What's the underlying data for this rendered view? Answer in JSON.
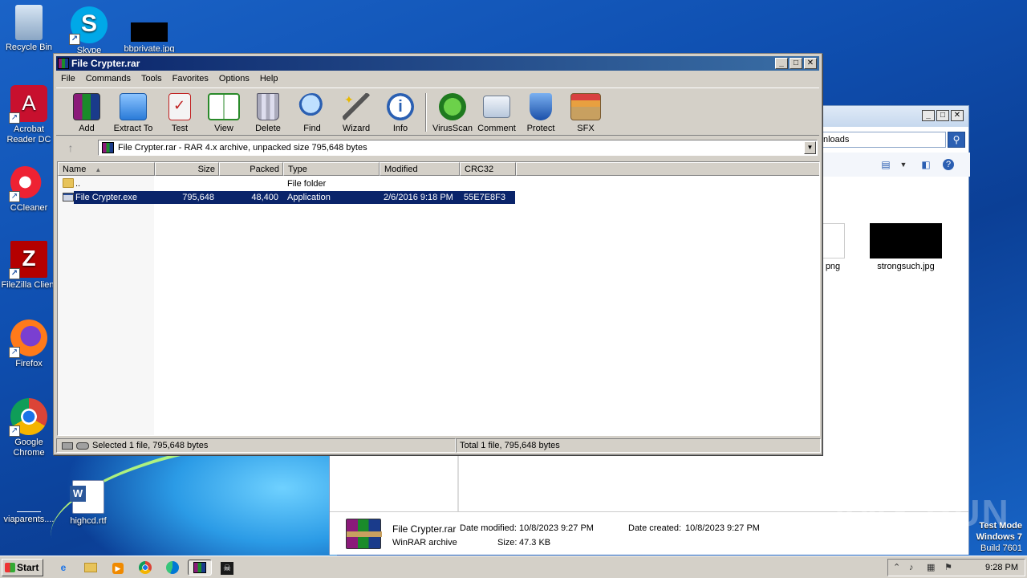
{
  "desktop": {
    "icons": [
      {
        "label": "Recycle Bin"
      },
      {
        "label": "Skype"
      },
      {
        "label": "bbprivate.jpg"
      },
      {
        "label": "Acrobat Reader DC"
      },
      {
        "label": "CCleaner"
      },
      {
        "label": "FileZilla Client"
      },
      {
        "label": "Firefox"
      },
      {
        "label": "Google Chrome"
      },
      {
        "label": "viaparents...."
      },
      {
        "label": "highcd.rtf"
      }
    ],
    "watermark": "ANY RUN",
    "test_mode": {
      "line1": "Test Mode",
      "line2": "Windows 7",
      "line3": "Build 7601"
    }
  },
  "explorer": {
    "search_text": "nloads",
    "files": [
      {
        "label": "png"
      },
      {
        "label": "strongsuch.jpg"
      }
    ],
    "details": {
      "name": "File Crypter.rar",
      "type": "WinRAR archive",
      "modified_label": "Date modified:",
      "modified_value": "10/8/2023 9:27 PM",
      "size_label": "Size:",
      "size_value": "47.3 KB",
      "created_label": "Date created:",
      "created_value": "10/8/2023 9:27 PM"
    }
  },
  "winrar": {
    "title": "File Crypter.rar",
    "menu": [
      "File",
      "Commands",
      "Tools",
      "Favorites",
      "Options",
      "Help"
    ],
    "toolbar": [
      {
        "label": "Add",
        "icon": "add-icon"
      },
      {
        "label": "Extract To",
        "icon": "extract-icon"
      },
      {
        "label": "Test",
        "icon": "test-icon"
      },
      {
        "label": "View",
        "icon": "view-icon"
      },
      {
        "label": "Delete",
        "icon": "delete-icon"
      },
      {
        "label": "Find",
        "icon": "find-icon"
      },
      {
        "label": "Wizard",
        "icon": "wizard-icon"
      },
      {
        "label": "Info",
        "icon": "info-icon"
      },
      {
        "label": "VirusScan",
        "icon": "virusscan-icon"
      },
      {
        "label": "Comment",
        "icon": "comment-icon"
      },
      {
        "label": "Protect",
        "icon": "protect-icon"
      },
      {
        "label": "SFX",
        "icon": "sfx-icon"
      }
    ],
    "address": "File Crypter.rar - RAR 4.x archive, unpacked size 795,648 bytes",
    "columns": [
      "Name",
      "Size",
      "Packed",
      "Type",
      "Modified",
      "CRC32"
    ],
    "rows": [
      {
        "name": "..",
        "size": "",
        "packed": "",
        "type": "File folder",
        "modified": "",
        "crc": ""
      },
      {
        "name": "File Crypter.exe",
        "size": "795,648",
        "packed": "48,400",
        "type": "Application",
        "modified": "2/6/2016 9:18 PM",
        "crc": "55E7E8F3"
      }
    ],
    "status_left": "Selected 1 file, 795,648 bytes",
    "status_right": "Total 1 file, 795,648 bytes"
  },
  "taskbar": {
    "start_label": "Start",
    "clock": "9:28 PM"
  },
  "colors": {
    "title_bar": "#0a246a",
    "selection": "#0a246a",
    "desktop": "#1a63c7"
  }
}
